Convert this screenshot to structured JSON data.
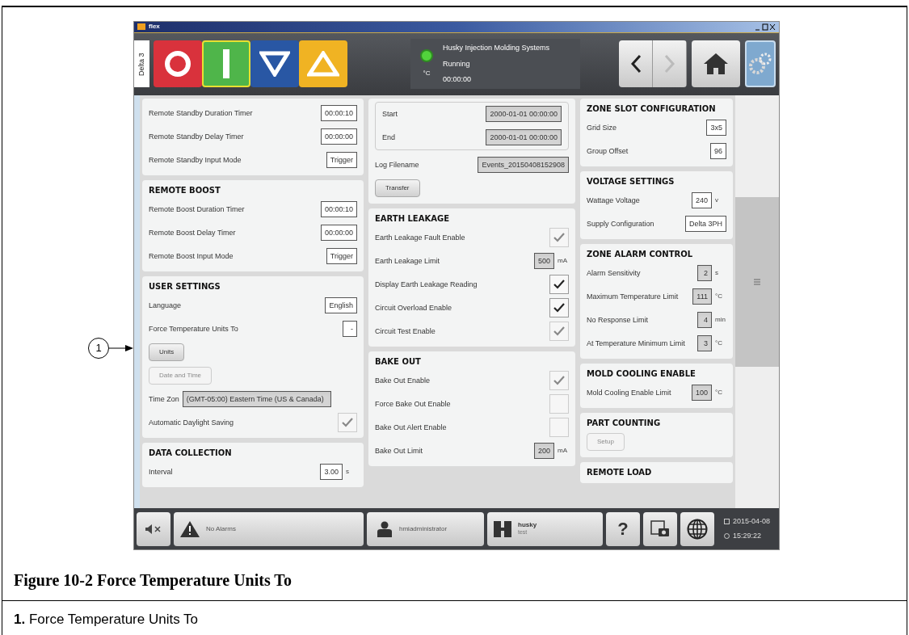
{
  "window": {
    "title": "flex"
  },
  "toolbar": {
    "machine_tab": "Delta 3",
    "mode_buttons": [
      {
        "kind": "stop",
        "selected": false
      },
      {
        "kind": "start",
        "selected": true
      },
      {
        "kind": "down",
        "selected": false
      },
      {
        "kind": "up",
        "selected": false
      }
    ],
    "status": {
      "unit": "°C",
      "company": "Husky Injection Molding Systems",
      "state": "Running",
      "time": "00:00:00"
    },
    "nav": [
      {
        "kind": "back",
        "disabled": false
      },
      {
        "kind": "forward",
        "disabled": true
      }
    ],
    "home_selected": false,
    "settings_selected": true
  },
  "columns": [
    [
      {
        "rows": [
          {
            "kind": "field",
            "label": "Remote Standby Duration Timer",
            "value": "00:00:10",
            "readonly": false
          },
          {
            "kind": "field",
            "label": "Remote Standby Delay Timer",
            "value": "00:00:00",
            "readonly": false
          },
          {
            "kind": "field",
            "label": "Remote Standby Input Mode",
            "value": "Trigger",
            "readonly": false
          }
        ]
      },
      {
        "title": "REMOTE BOOST",
        "rows": [
          {
            "kind": "field",
            "label": "Remote Boost Duration Timer",
            "value": "00:00:10",
            "readonly": false
          },
          {
            "kind": "field",
            "label": "Remote Boost Delay Timer",
            "value": "00:00:00",
            "readonly": false
          },
          {
            "kind": "field",
            "label": "Remote Boost Input Mode",
            "value": "Trigger",
            "readonly": false
          }
        ]
      },
      {
        "title": "USER SETTINGS",
        "rows": [
          {
            "kind": "field",
            "label": "Language",
            "value": "English",
            "readonly": false
          },
          {
            "kind": "field",
            "label": "Force Temperature Units To",
            "value": "-",
            "readonly": false
          },
          {
            "kind": "button",
            "label": "Units",
            "disabled": false
          },
          {
            "kind": "button",
            "label": "Date and Time",
            "disabled": true
          },
          {
            "kind": "wide",
            "label": "Time Zon",
            "value": "(GMT-05:00) Eastern Time (US & Canada)",
            "readonly": true
          },
          {
            "kind": "check",
            "label": "Automatic Daylight Saving",
            "checked": true,
            "disabled": true
          }
        ]
      },
      {
        "title": "DATA COLLECTION",
        "rows": [
          {
            "kind": "field",
            "label": "Interval",
            "value": "3.00",
            "readonly": false,
            "unit": "s"
          }
        ]
      }
    ],
    [
      {
        "inset": [
          {
            "kind": "field",
            "label": "Start",
            "value": "2000-01-01 00:00:00",
            "readonly": true
          },
          {
            "kind": "field",
            "label": "End",
            "value": "2000-01-01 00:00:00",
            "readonly": true
          }
        ],
        "rows": [
          {
            "kind": "field",
            "label": "Log Filename",
            "value": "Events_20150408152908",
            "readonly": true
          },
          {
            "kind": "button",
            "label": "Transfer",
            "disabled": false
          }
        ]
      },
      {
        "title": "EARTH LEAKAGE",
        "rows": [
          {
            "kind": "check",
            "label": "Earth Leakage Fault Enable",
            "checked": true,
            "disabled": true
          },
          {
            "kind": "field",
            "label": "Earth Leakage Limit",
            "value": "500",
            "readonly": true,
            "unit": "mA"
          },
          {
            "kind": "check",
            "label": "Display Earth Leakage Reading",
            "checked": true,
            "disabled": false
          },
          {
            "kind": "check",
            "label": "Circuit Overload Enable",
            "checked": true,
            "disabled": false
          },
          {
            "kind": "check",
            "label": "Circuit Test Enable",
            "checked": true,
            "disabled": true
          }
        ]
      },
      {
        "title": "BAKE OUT",
        "rows": [
          {
            "kind": "check",
            "label": "Bake Out Enable",
            "checked": true,
            "disabled": true
          },
          {
            "kind": "check",
            "label": "Force Bake Out Enable",
            "checked": false,
            "disabled": true
          },
          {
            "kind": "check",
            "label": "Bake Out Alert Enable",
            "checked": false,
            "disabled": true
          },
          {
            "kind": "field",
            "label": "Bake Out Limit",
            "value": "200",
            "readonly": true,
            "unit": "mA"
          }
        ]
      }
    ],
    [
      {
        "title": "ZONE SLOT CONFIGURATION",
        "rows": [
          {
            "kind": "field",
            "label": "Grid Size",
            "value": "3x5",
            "readonly": false
          },
          {
            "kind": "field",
            "label": "Group Offset",
            "value": "96",
            "readonly": false
          }
        ]
      },
      {
        "title": "VOLTAGE SETTINGS",
        "rows": [
          {
            "kind": "field",
            "label": "Wattage Voltage",
            "value": "240",
            "readonly": false,
            "unit": "v"
          },
          {
            "kind": "field",
            "label": "Supply Configuration",
            "value": "Delta 3PH",
            "readonly": false
          }
        ]
      },
      {
        "title": "ZONE ALARM CONTROL",
        "rows": [
          {
            "kind": "field",
            "label": "Alarm Sensitivity",
            "value": "2",
            "readonly": true,
            "unit": "s"
          },
          {
            "kind": "field",
            "label": "Maximum Temperature Limit",
            "value": "111",
            "readonly": true,
            "unit": "°C"
          },
          {
            "kind": "field",
            "label": "No Response Limit",
            "value": "4",
            "readonly": true,
            "unit": "min"
          },
          {
            "kind": "field",
            "label": "At Temperature Minimum Limit",
            "value": "3",
            "readonly": true,
            "unit": "°C"
          }
        ]
      },
      {
        "title": "MOLD COOLING ENABLE",
        "rows": [
          {
            "kind": "field",
            "label": "Mold Cooling Enable Limit",
            "value": "100",
            "readonly": true,
            "unit": "°C"
          }
        ]
      },
      {
        "title": "PART COUNTING",
        "rows": [
          {
            "kind": "button",
            "label": "Setup",
            "disabled": true
          }
        ]
      },
      {
        "title": "REMOTE LOAD"
      }
    ]
  ],
  "status_bar": {
    "alarms": "No Alarms",
    "user": "hmiadministrator",
    "mold": "husky",
    "mold_sub": "test",
    "help": "?",
    "date": "2015-04-08",
    "time": "15:29:22"
  },
  "callout": "1",
  "caption": {
    "title": "Figure 10-2 Force Temperature Units To",
    "items": [
      {
        "number": "1.",
        "text": "Force Temperature Units To"
      }
    ]
  }
}
